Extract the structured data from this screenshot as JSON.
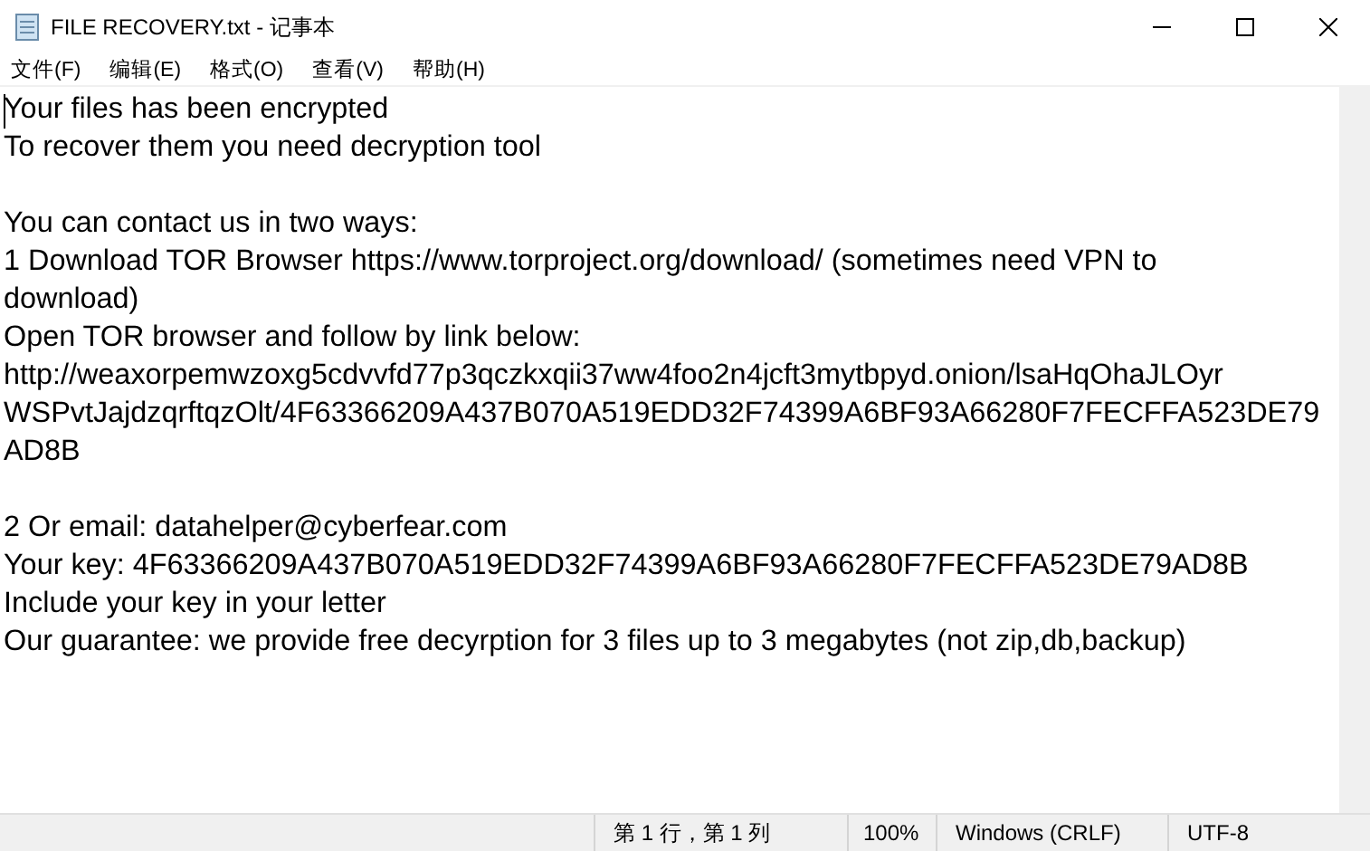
{
  "window": {
    "title": "FILE RECOVERY.txt - 记事本"
  },
  "menu": [
    "文件(F)",
    "编辑(E)",
    "格式(O)",
    "查看(V)",
    "帮助(H)"
  ],
  "document": {
    "paragraphs": [
      {
        "lines": [
          "Your files has been encrypted",
          "To recover them you need decryption tool"
        ]
      },
      {
        "lines": [
          "You can contact us in two ways:",
          "1 Download TOR Browser https://www.torproject.org/download/ (sometimes need VPN to",
          "download)",
          "Open TOR browser and follow by link below:",
          "http://weaxorpemwzoxg5cdvvfd77p3qczkxqii37ww4foo2n4jcft3mytbpyd.onion/lsaHqOhaJLOyr",
          "WSPvtJajdzqrftqzOlt/4F63366209A437B070A519EDD32F74399A6BF93A66280F7FECFFA523DE79",
          "AD8B"
        ]
      },
      {
        "lines": [
          "2 Or email: datahelper@cyberfear.com",
          "Your key: 4F63366209A437B070A519EDD32F74399A6BF93A66280F7FECFFA523DE79AD8B",
          "Include your key in your letter",
          "Our guarantee: we provide free decyrption for 3 files up to 3 megabytes (not zip,db,backup)"
        ]
      }
    ]
  },
  "status_bar": {
    "position": "第 1 行，第 1 列",
    "zoom": "100%",
    "line_ending": "Windows (CRLF)",
    "encoding": "UTF-8"
  }
}
